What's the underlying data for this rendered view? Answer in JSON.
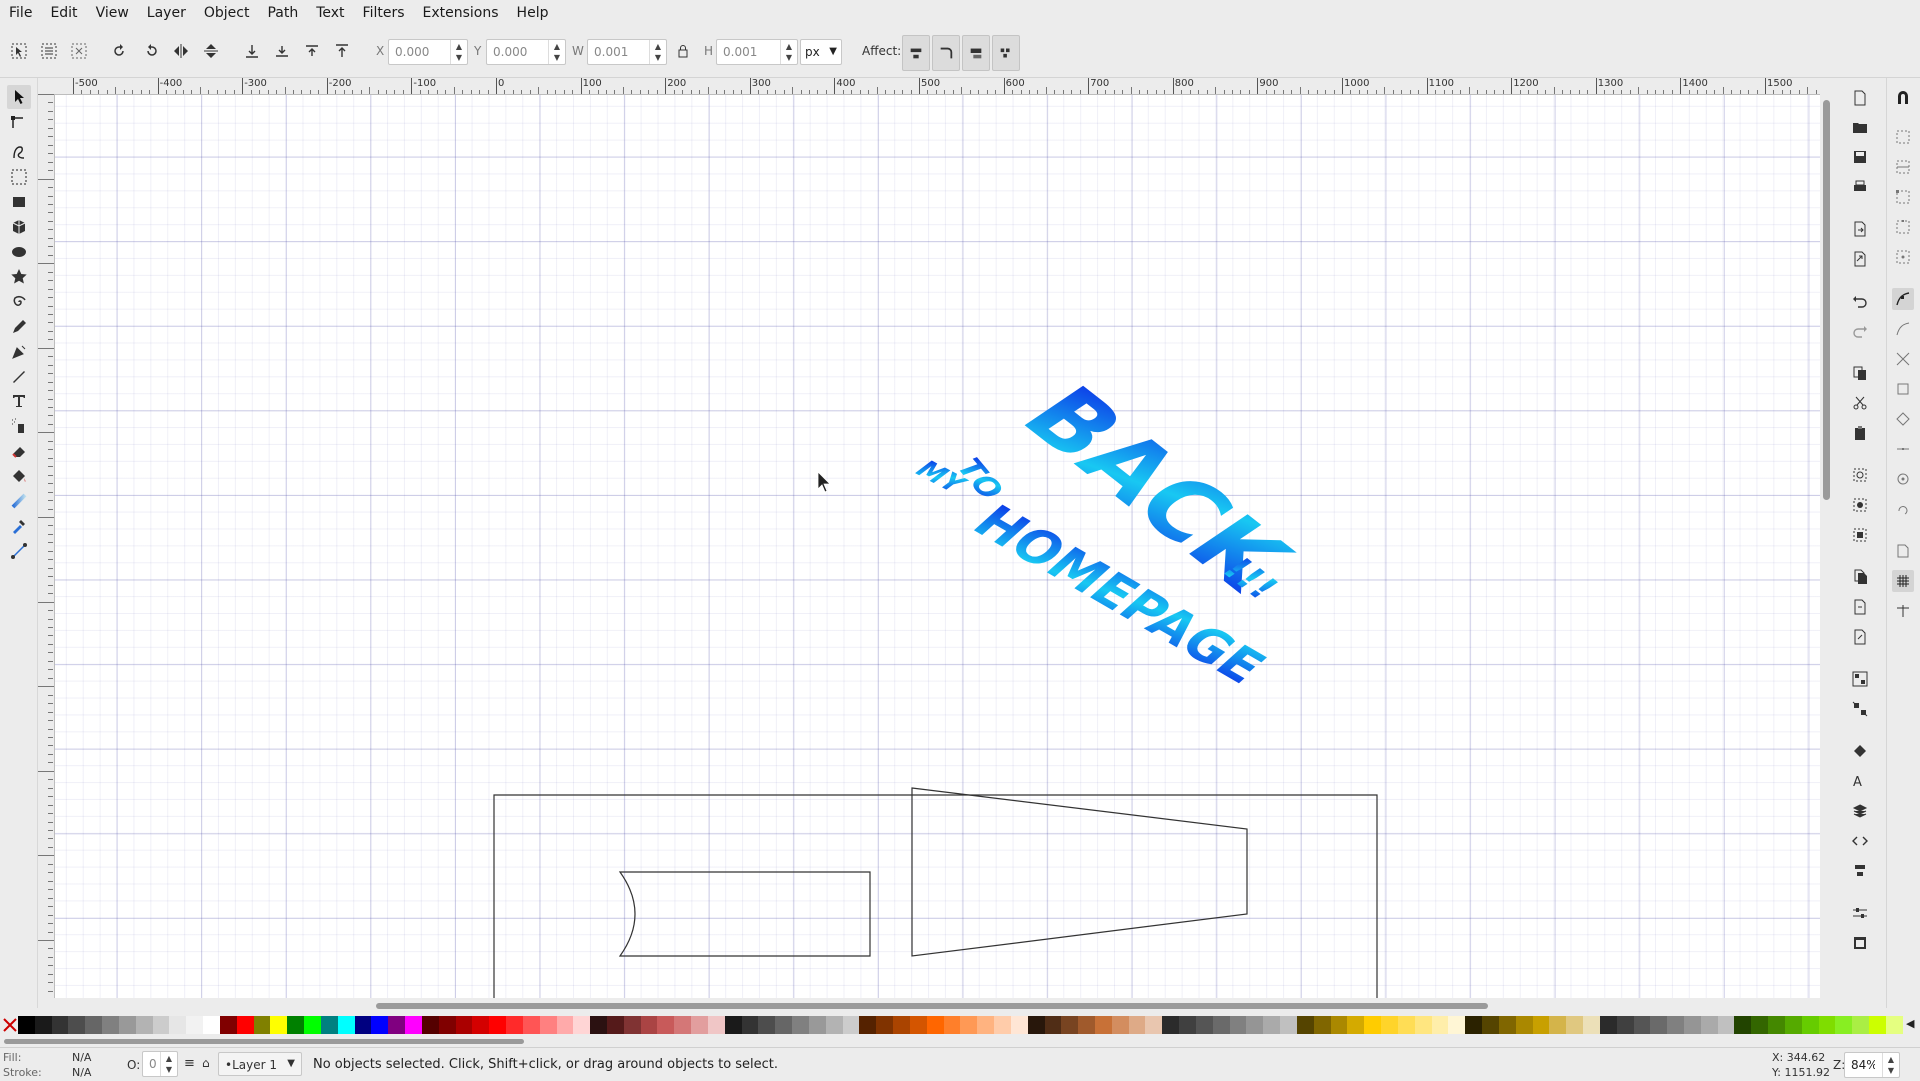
{
  "menu": [
    "File",
    "Edit",
    "View",
    "Layer",
    "Object",
    "Path",
    "Text",
    "Filters",
    "Extensions",
    "Help"
  ],
  "toolbar": {
    "x_label": "X",
    "x_value": "0.000",
    "y_label": "Y",
    "y_value": "0.000",
    "w_label": "W",
    "w_value": "0.001",
    "h_label": "H",
    "h_value": "0.001",
    "unit": "px",
    "affect_label": "Affect:"
  },
  "ruler": {
    "h_ticks": [
      "-500",
      "-400",
      "-300",
      "-200",
      "-100",
      "0",
      "100",
      "200",
      "300",
      "400",
      "500",
      "600",
      "700",
      "800",
      "900",
      "1000",
      "1100",
      "1200",
      "1300",
      "1400",
      "1500"
    ]
  },
  "artwork": {
    "line1": "BACK",
    "line2": "TO",
    "line3": "MY",
    "line4": "HOMEPAGE",
    "exclaim": "!!!",
    "gradient_start": "#0a20e6",
    "gradient_end": "#18c8f2"
  },
  "palette_colors": [
    "#000000",
    "#1a1a1a",
    "#333333",
    "#4d4d4d",
    "#666666",
    "#808080",
    "#999999",
    "#b3b3b3",
    "#cccccc",
    "#e6e6e6",
    "#f2f2f2",
    "#ffffff",
    "#800000",
    "#ff0000",
    "#808000",
    "#ffff00",
    "#008000",
    "#00ff00",
    "#008080",
    "#00ffff",
    "#000080",
    "#0000ff",
    "#800080",
    "#ff00ff",
    "#550000",
    "#800000",
    "#aa0000",
    "#d40000",
    "#ff0000",
    "#ff2a2a",
    "#ff5555",
    "#ff8080",
    "#ffaaaa",
    "#ffd5d5",
    "#2b1111",
    "#551a1a",
    "#803333",
    "#aa4444",
    "#c85a5a",
    "#d47777",
    "#e29e9e",
    "#f0c6c6",
    "#1a1a1a",
    "#333333",
    "#4d4d4d",
    "#666666",
    "#808080",
    "#999999",
    "#b3b3b3",
    "#cccccc",
    "#552200",
    "#803300",
    "#aa4400",
    "#d45500",
    "#ff6600",
    "#ff7f2a",
    "#ff9955",
    "#ffb380",
    "#ffccaa",
    "#ffe6d5",
    "#28170b",
    "#502d16",
    "#784421",
    "#a05a2c",
    "#c87137",
    "#d38d5f",
    "#deaa87",
    "#e9c6af",
    "#2b2b2b",
    "#404040",
    "#555555",
    "#6a6a6a",
    "#808080",
    "#959595",
    "#aaaaaa",
    "#c0c0c0",
    "#554400",
    "#806600",
    "#aa8800",
    "#d4aa00",
    "#ffcc00",
    "#ffd42a",
    "#ffdd55",
    "#ffe680",
    "#ffeeaa",
    "#fff6d5",
    "#2b2200",
    "#554400",
    "#806600",
    "#aa8800",
    "#c8a000",
    "#d4b44a",
    "#e0c880",
    "#ece0b8",
    "#2b2b2b",
    "#404040",
    "#555555",
    "#6a6a6a",
    "#808080",
    "#959595",
    "#aaaaaa",
    "#c0c0c0",
    "#224400",
    "#336600",
    "#448800",
    "#55aa00",
    "#66cc00",
    "#7fdd00",
    "#88ee22",
    "#aaee44",
    "#ccff00",
    "#e5ff80"
  ],
  "status": {
    "fill_label": "Fill:",
    "fill_value": "N/A",
    "stroke_label": "Stroke:",
    "stroke_value": "N/A",
    "opacity_label": "O:",
    "opacity_value": "0",
    "layer": "•Layer 1",
    "message": "No objects selected. Click, Shift+click, or drag around objects to select.",
    "x_coord": "X: 344.62",
    "y_coord": "Y: 1151.92",
    "zoom_label": "Z:",
    "zoom": "84%"
  }
}
